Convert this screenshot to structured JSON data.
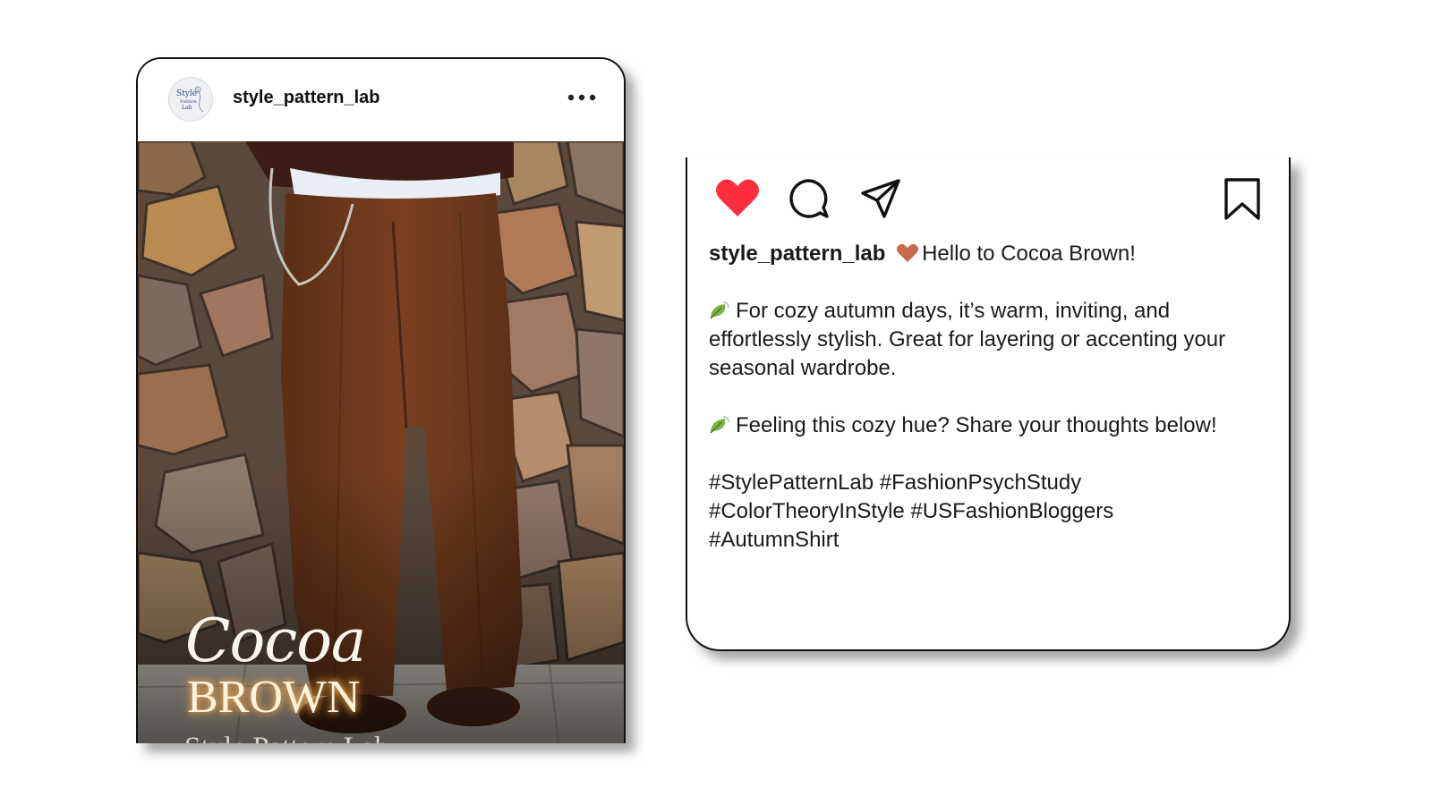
{
  "post": {
    "username": "style_pattern_lab",
    "avatar_icon": "style-pattern-lab-logo",
    "more_icon": "more-options-icon",
    "overlay": {
      "title_line1": "Cocoa",
      "title_line2": "BROWN",
      "brand": "Style Pattern Lab"
    }
  },
  "caption": {
    "actions": {
      "like_icon": "heart-icon",
      "like_color": "#ff2d3d",
      "comment_icon": "comment-icon",
      "share_icon": "send-icon",
      "save_icon": "bookmark-icon"
    },
    "username": "style_pattern_lab",
    "heart_emoji_color": "#c8694d",
    "greeting": "Hello to Cocoa Brown!",
    "paragraph1": "For cozy autumn days, it’s warm, inviting, and effortlessly stylish. Great for layering or accenting your seasonal wardrobe.",
    "paragraph2": "Feeling this cozy hue? Share your thoughts below!",
    "hashtags": "#StylePatternLab #FashionPsychStudy #ColorTheoryInStyle #USFashionBloggers #AutumnShirt",
    "leaf_icon": "leaf-icon"
  }
}
